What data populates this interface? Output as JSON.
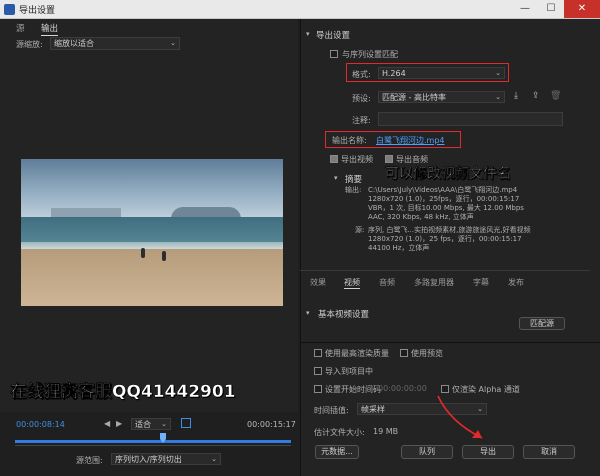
{
  "window": {
    "title": "导出设置",
    "minimize": "—",
    "maximize": "☐",
    "close": "✕"
  },
  "left_tabs": [
    "源",
    "输出"
  ],
  "source_scaling": {
    "label": "源缩放:",
    "value": "缩放以适合"
  },
  "promo_text": "在线狸窝客服QQ41442901",
  "timeline": {
    "current_tc": "00:00:08:14",
    "end_tc": "00:00:15:17",
    "fit_value": "适合",
    "source_range_label": "源范围:",
    "source_range_value": "序列切入/序列切出",
    "playhead_fraction": 0.54
  },
  "export_settings": {
    "section_title": "导出设置",
    "match_sequence_label": "与序列设置匹配",
    "format_label": "格式:",
    "format_value": "H.264",
    "preset_label": "预设:",
    "preset_value": "匹配源 - 高比特率",
    "comments_label": "注释:",
    "output_name_label": "输出名称:",
    "output_name_value": "白鹭飞翔河边.mp4",
    "export_video_label": "导出视频",
    "export_audio_label": "导出音频",
    "annotation": "可以修改视频文件名",
    "summary_label": "摘要",
    "summary_output_label": "输出:",
    "summary_output_lines": [
      "C:\\Users\\July\\Videos\\AAA\\白鹭飞翔河边.mp4",
      "1280x720 (1.0)，25fps，逐行，00:00:15:17",
      "VBR，1 次, 目标10.00 Mbps, 最大 12.00 Mbps",
      "AAC, 320 Kbps, 48  kHz, 立体声"
    ],
    "summary_source_label": "源:",
    "summary_source_lines": [
      "序列, 白鹭飞...实拍视频素材,旅游旅途风光,好看视频",
      "1280x720 (1.0)，25 fps，逐行，00:00:15:17",
      "44100 Hz，立体声"
    ]
  },
  "right_tabs": [
    "效果",
    "视频",
    "音频",
    "多路复用器",
    "字幕",
    "发布"
  ],
  "basic_video": {
    "section_title": "基本视频设置",
    "match_source_button": "匹配源"
  },
  "bottom_options": {
    "max_render_quality": "使用最高渲染质量",
    "use_previews": "使用预览",
    "import_project": "导入到项目中",
    "set_start_timecode": "设置开始时间码",
    "start_timecode_value": "00:00:00:00",
    "alpha_only": "仅渲染 Alpha 通道",
    "time_interp_label": "时间插值:",
    "time_interp_value": "帧采样",
    "estimated_size_label": "估计文件大小:",
    "estimated_size_value": "19 MB"
  },
  "buttons": {
    "metadata": "元数据...",
    "queue": "队列",
    "export": "导出",
    "cancel": "取消"
  },
  "colors": {
    "accent": "#3f8fe6",
    "annotation_red": "#e12a2a"
  }
}
